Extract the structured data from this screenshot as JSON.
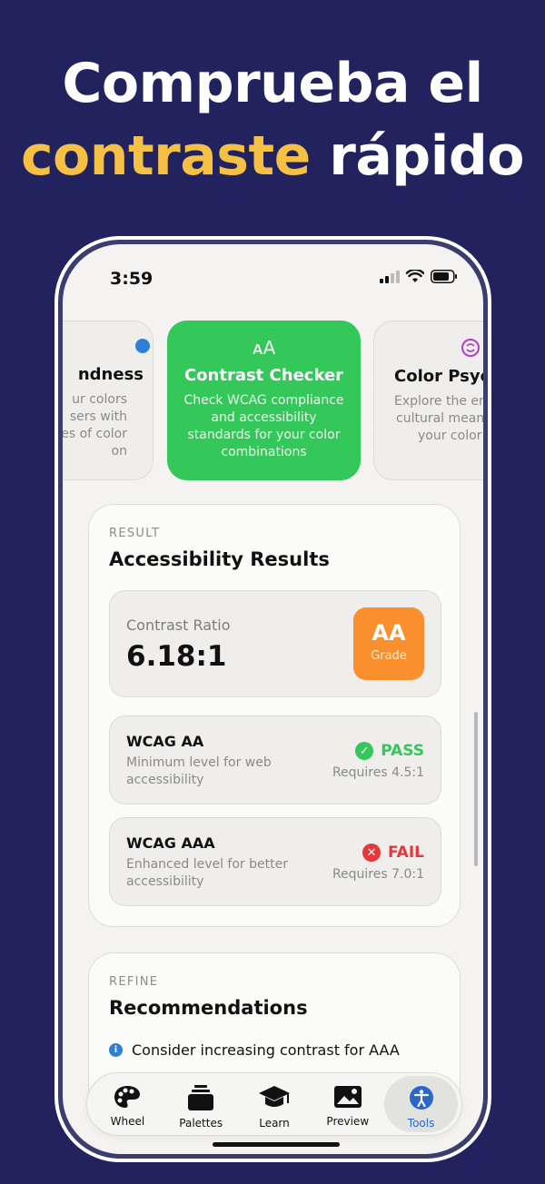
{
  "headline": {
    "line1": "Comprueba el",
    "accent": "contraste",
    "line2_rest": " rápido"
  },
  "status_bar": {
    "time": "3:59"
  },
  "carousel": {
    "left_card": {
      "title": "ndness",
      "desc_lines": [
        "ur colors",
        "sers with",
        "es of color",
        "on"
      ]
    },
    "active_card": {
      "icon_text": "ᴀA",
      "title": "Contrast Checker",
      "desc": "Check WCAG compliance and accessibility standards for your color combinations"
    },
    "right_card": {
      "title": "Color Psyc",
      "desc_lines": [
        "Explore the em",
        "cultural meanin",
        "your color c"
      ]
    }
  },
  "result": {
    "eyebrow": "RESULT",
    "title": "Accessibility Results",
    "ratio_label": "Contrast Ratio",
    "ratio_value": "6.18:1",
    "grade": "AA",
    "grade_label": "Grade",
    "levels": [
      {
        "name": "WCAG AA",
        "desc": "Minimum level for web accessibility",
        "status": "PASS",
        "requires": "Requires 4.5:1",
        "status_color": "#34c759"
      },
      {
        "name": "WCAG AAA",
        "desc": "Enhanced level for better accessibility",
        "status": "FAIL",
        "requires": "Requires 7.0:1",
        "status_color": "#e5383b"
      }
    ]
  },
  "refine": {
    "eyebrow": "REFINE",
    "title": "Recommendations",
    "item": "Consider increasing contrast for AAA"
  },
  "tabs": [
    {
      "label": "Wheel",
      "icon": "palette-icon"
    },
    {
      "label": "Palettes",
      "icon": "stack-icon"
    },
    {
      "label": "Learn",
      "icon": "graduation-cap-icon"
    },
    {
      "label": "Preview",
      "icon": "photo-icon"
    },
    {
      "label": "Tools",
      "icon": "accessibility-icon",
      "active": true
    }
  ],
  "colors": {
    "background": "#22235e",
    "accent_yellow": "#f6c045",
    "card_green": "#34c759",
    "grade_orange": "#fa8f2d",
    "pass_green": "#34c759",
    "fail_red": "#e5383b",
    "tab_active": "#2b66c9"
  }
}
